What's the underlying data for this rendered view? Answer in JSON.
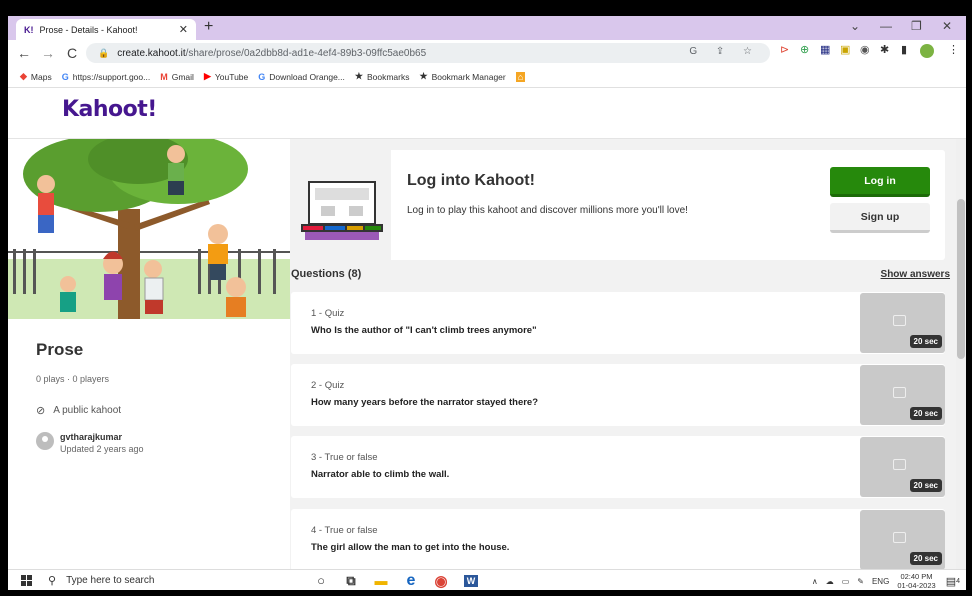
{
  "browser": {
    "tab_title": "Prose - Details - Kahoot!",
    "tab_favicon": "K!",
    "url_host": "create.kahoot.it",
    "url_path": "/share/prose/0a2dbb8d-ad1e-4ef4-89b3-09ffc5ae0b65",
    "bookmarks": [
      {
        "icon": "maps-icon",
        "label": "Maps"
      },
      {
        "icon": "google-icon",
        "label": "https://support.goo..."
      },
      {
        "icon": "gmail-icon",
        "label": "Gmail"
      },
      {
        "icon": "youtube-icon",
        "label": "YouTube"
      },
      {
        "icon": "google-icon",
        "label": "Download Orange..."
      },
      {
        "icon": "star-icon",
        "label": "Bookmarks"
      },
      {
        "icon": "star-icon",
        "label": "Bookmark Manager"
      }
    ]
  },
  "site": {
    "logo": "Kahoot!"
  },
  "kahoot": {
    "title": "Prose",
    "stats": "0 plays · 0 players",
    "visibility": "A public kahoot",
    "author": "gvtharajkumar",
    "updated": "Updated 2 years ago"
  },
  "login": {
    "title": "Log into Kahoot!",
    "text": "Log in to play this kahoot and discover millions more you'll love!",
    "login_label": "Log in",
    "signup_label": "Sign up"
  },
  "questions_header": "Questions (8)",
  "show_answers": "Show answers",
  "questions": [
    {
      "type": "1 - Quiz",
      "text": "Who Is the author of \"I can't climb trees anymore\"",
      "time": "20 sec"
    },
    {
      "type": "2 - Quiz",
      "text": "How many years before the narrator stayed there?",
      "time": "20 sec"
    },
    {
      "type": "3 - True or false",
      "text": "Narrator able to climb the wall.",
      "time": "20 sec"
    },
    {
      "type": "4 - True or false",
      "text": "The girl allow the man to get into the house.",
      "time": "20 sec"
    }
  ],
  "taskbar": {
    "search_placeholder": "Type here to search",
    "lang": "ENG",
    "time": "02:40 PM",
    "date": "01-04-2023",
    "notification_count": "4"
  },
  "colors": {
    "brand_purple": "#46178f",
    "login_green": "#26890c"
  }
}
